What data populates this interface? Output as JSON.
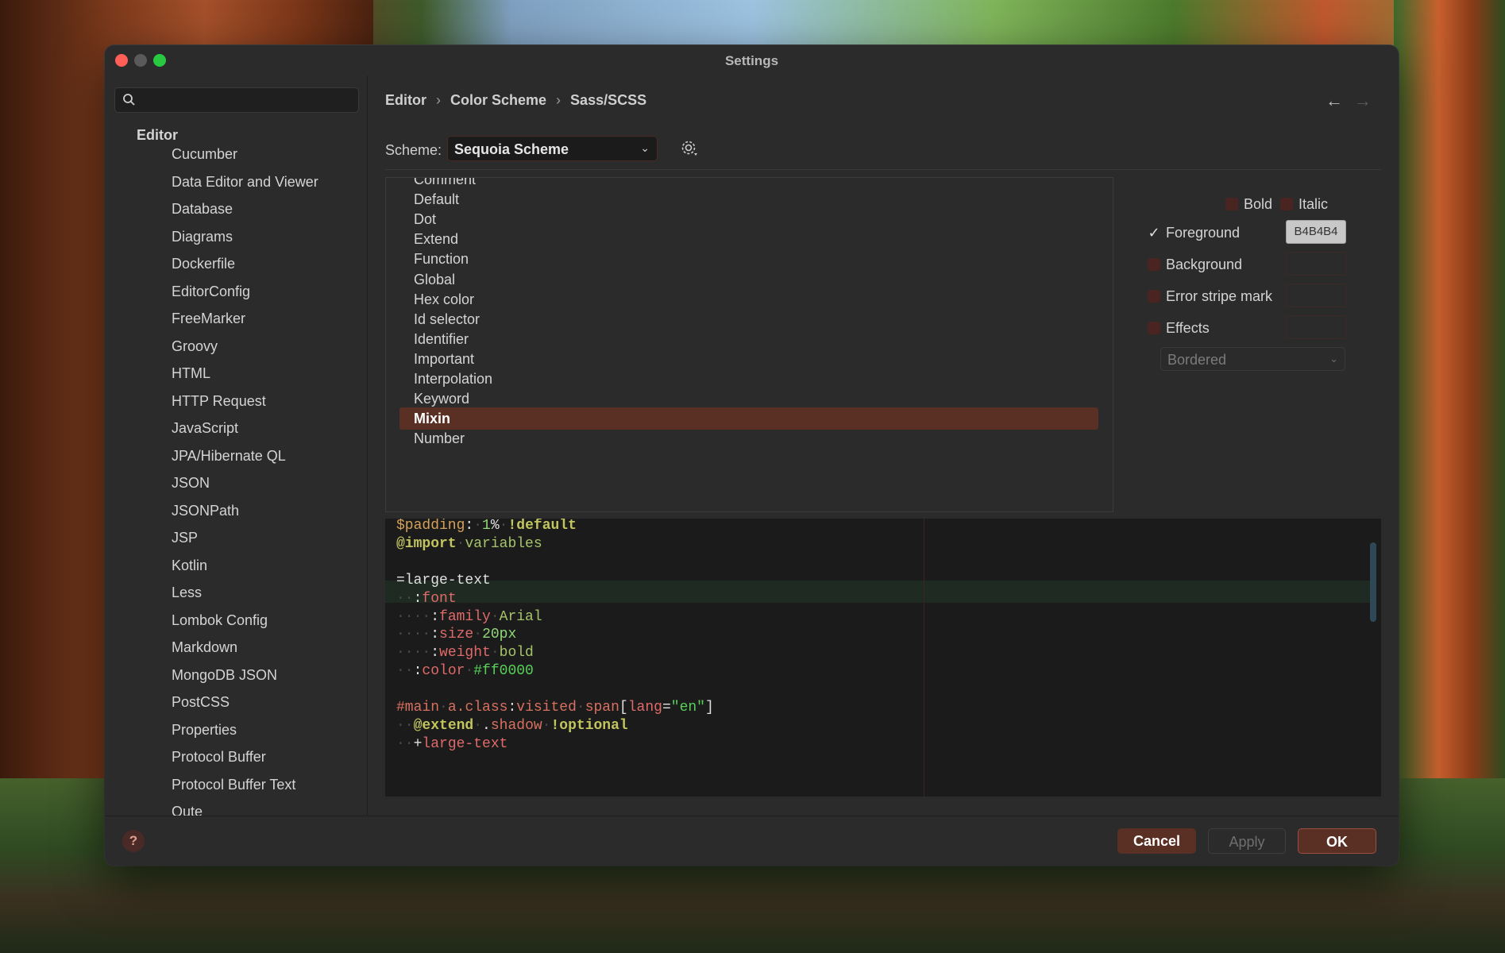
{
  "window": {
    "title": "Settings"
  },
  "sidebar": {
    "search_placeholder": "",
    "root": "Editor",
    "items": [
      "Cucumber",
      "Data Editor and Viewer",
      "Database",
      "Diagrams",
      "Dockerfile",
      "EditorConfig",
      "FreeMarker",
      "Groovy",
      "HTML",
      "HTTP Request",
      "JavaScript",
      "JPA/Hibernate QL",
      "JSON",
      "JSONPath",
      "JSP",
      "Kotlin",
      "Less",
      "Lombok Config",
      "Markdown",
      "MongoDB JSON",
      "PostCSS",
      "Properties",
      "Protocol Buffer",
      "Protocol Buffer Text",
      "Qute"
    ]
  },
  "breadcrumb": {
    "items": [
      "Editor",
      "Color Scheme",
      "Sass/SCSS"
    ],
    "separator": "›"
  },
  "nav": {
    "back": "←",
    "forward": "→"
  },
  "scheme": {
    "label": "Scheme:",
    "value": "Sequoia Scheme"
  },
  "element_list": {
    "items": [
      "Comment",
      "Default",
      "Dot",
      "Extend",
      "Function",
      "Global",
      "Hex color",
      "Id selector",
      "Identifier",
      "Important",
      "Interpolation",
      "Keyword",
      "Mixin",
      "Number"
    ],
    "selected": "Mixin"
  },
  "properties": {
    "bold_label": "Bold",
    "italic_label": "Italic",
    "foreground_label": "Foreground",
    "foreground_checked": true,
    "foreground_value": "B4B4B4",
    "background_label": "Background",
    "error_stripe_label": "Error stripe mark",
    "effects_label": "Effects",
    "effects_type": "Bordered"
  },
  "preview": {
    "lines": [
      [
        [
          "c-var",
          "$padding"
        ],
        [
          "c-txt",
          ":"
        ],
        [
          "c-dot",
          "·"
        ],
        [
          "c-num",
          "1"
        ],
        [
          "c-txt",
          "%"
        ],
        [
          "c-dot",
          "·"
        ],
        [
          "c-kw",
          "!default"
        ]
      ],
      [
        [
          "c-kw",
          "@import"
        ],
        [
          "c-dot",
          "·"
        ],
        [
          "c-str",
          "variables"
        ]
      ],
      [],
      [
        [
          "c-txt",
          "=large-text"
        ]
      ],
      [
        [
          "c-dot",
          "··"
        ],
        [
          "c-txt",
          ":"
        ],
        [
          "c-prop",
          "font"
        ]
      ],
      [
        [
          "c-dot",
          "····"
        ],
        [
          "c-txt",
          ":"
        ],
        [
          "c-prop",
          "family"
        ],
        [
          "c-dot",
          "·"
        ],
        [
          "c-str",
          "Arial"
        ]
      ],
      [
        [
          "c-dot",
          "····"
        ],
        [
          "c-txt",
          ":"
        ],
        [
          "c-prop",
          "size"
        ],
        [
          "c-dot",
          "·"
        ],
        [
          "c-num",
          "20px"
        ]
      ],
      [
        [
          "c-dot",
          "····"
        ],
        [
          "c-txt",
          ":"
        ],
        [
          "c-prop",
          "weight"
        ],
        [
          "c-dot",
          "·"
        ],
        [
          "c-str",
          "bold"
        ]
      ],
      [
        [
          "c-dot",
          "··"
        ],
        [
          "c-txt",
          ":"
        ],
        [
          "c-prop",
          "color"
        ],
        [
          "c-dot",
          "·"
        ],
        [
          "c-green",
          "#ff0000"
        ]
      ],
      [],
      [
        [
          "c-sel",
          "#main"
        ],
        [
          "c-dot",
          "·"
        ],
        [
          "c-sel",
          "a"
        ],
        [
          "c-sel",
          ".class"
        ],
        [
          "c-txt",
          ":"
        ],
        [
          "c-sel",
          "visited"
        ],
        [
          "c-dot",
          "·"
        ],
        [
          "c-sel",
          "span"
        ],
        [
          "c-txt",
          "["
        ],
        [
          "c-prop",
          "lang"
        ],
        [
          "c-txt",
          "="
        ],
        [
          "c-green",
          "\"en\""
        ],
        [
          "c-txt",
          "]"
        ]
      ],
      [
        [
          "c-dot",
          "··"
        ],
        [
          "c-kw",
          "@extend"
        ],
        [
          "c-dot",
          "·"
        ],
        [
          "c-txt",
          "."
        ],
        [
          "c-sel",
          "shadow"
        ],
        [
          "c-dot",
          "·"
        ],
        [
          "c-kw",
          "!optional"
        ]
      ],
      [
        [
          "c-dot",
          "··"
        ],
        [
          "c-txt",
          "+"
        ],
        [
          "c-prop",
          "large-text"
        ]
      ]
    ]
  },
  "footer": {
    "help": "?",
    "cancel": "Cancel",
    "apply": "Apply",
    "ok": "OK"
  }
}
